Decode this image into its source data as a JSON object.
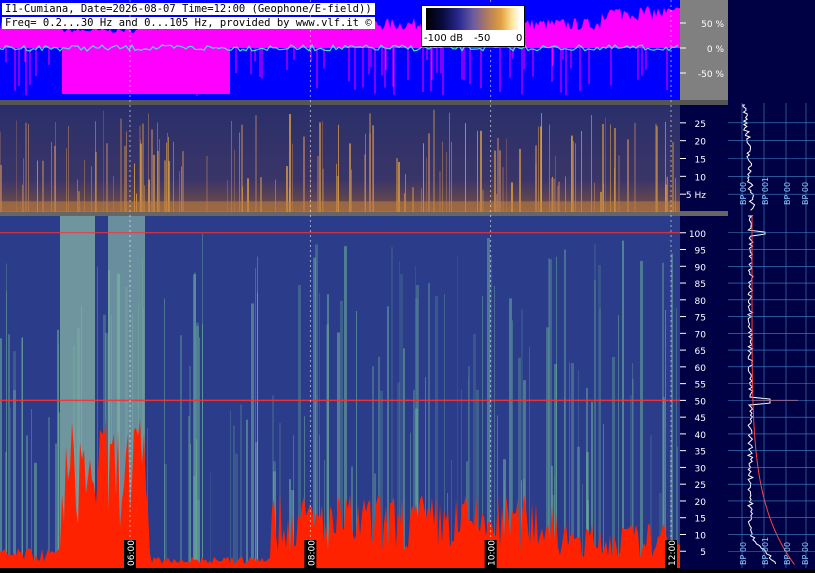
{
  "header": {
    "line1": "I1-Cumiana, Date=2026-08-07 Time=12:00 (Geophone/E-field))",
    "line2": "Freq= 0.2...30 Hz and 0...105 Hz, provided by www.vlf.it ©"
  },
  "colorbar": {
    "labels": [
      "-100 dB",
      "-50",
      "0"
    ]
  },
  "colors": {
    "waveform_bg": "#0000ff",
    "amplitude_fill": "#ff00ff",
    "signal_trace": "#40e0e0",
    "axis_panel": "#000044",
    "spectrogram_bg": "#2a3c8a",
    "intensity_hot": "#ff2200",
    "mains_line": "#ff3030",
    "profile_trace": "#ffffff",
    "grid": "#4488cc"
  },
  "chart_data": [
    {
      "type": "line",
      "panel": "waveform",
      "yticks": [
        "50 %",
        "0 %",
        "-50 %"
      ],
      "ytick_values": [
        50,
        0,
        -50
      ],
      "ylim": [
        -100,
        100
      ],
      "grid": true
    },
    {
      "type": "heatmap",
      "panel": "spectrogram-low",
      "yticks": [
        "25",
        "20",
        "15",
        "10",
        "5 Hz"
      ],
      "ytick_values": [
        25,
        20,
        15,
        10,
        5
      ],
      "ylim": [
        0,
        30
      ],
      "profile_labels": [
        "BP 00",
        "BP 001",
        "BP 00",
        "BP 00"
      ],
      "grid": true
    },
    {
      "type": "heatmap",
      "panel": "spectrogram-high",
      "yticks": [
        "100",
        "95",
        "90",
        "85",
        "80",
        "75",
        "70",
        "65",
        "60",
        "55",
        "50",
        "45",
        "40",
        "35",
        "30",
        "25",
        "20",
        "15",
        "10",
        "5"
      ],
      "ytick_values": [
        100,
        95,
        90,
        85,
        80,
        75,
        70,
        65,
        60,
        55,
        50,
        45,
        40,
        35,
        30,
        25,
        20,
        15,
        10,
        5
      ],
      "ylim": [
        0,
        105
      ],
      "time_labels": [
        "06:00",
        "08:00",
        "10:00",
        "12:00"
      ],
      "time_values": [
        6,
        8,
        10,
        12
      ],
      "xlim": [
        4.5,
        12
      ],
      "mains_hz": 50,
      "profile_labels": [
        "BP 00",
        "BP 001",
        "BP 00",
        "BP 00"
      ],
      "grid": true
    }
  ]
}
